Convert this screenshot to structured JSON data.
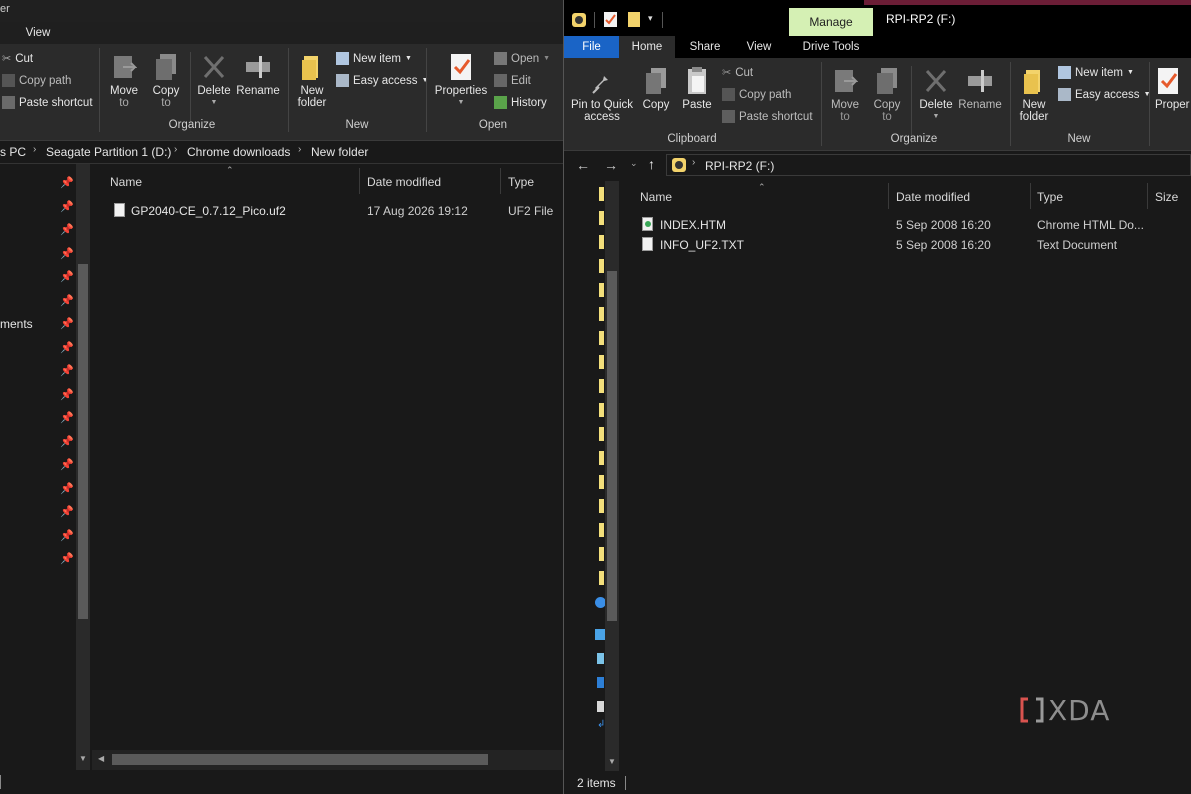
{
  "left": {
    "titlebar_text": "er",
    "tab_view": "View",
    "ribbon": {
      "cut": "Cut",
      "copy_path": "Copy path",
      "paste_shortcut": "Paste shortcut",
      "move_to": "Move",
      "move_to_2": "to",
      "copy_to": "Copy",
      "copy_to_2": "to",
      "delete": "Delete",
      "rename": "Rename",
      "new_folder": "New",
      "new_folder_2": "folder",
      "new_item": "New item",
      "easy_access": "Easy access",
      "properties": "Properties",
      "open": "Open",
      "edit": "Edit",
      "history": "History",
      "group_organize": "Organize",
      "group_new": "New",
      "group_open": "Open"
    },
    "breadcrumb": [
      "s PC",
      "Seagate Partition 1 (D:)",
      "Chrome downloads",
      "New folder"
    ],
    "nav_partial_label": "ments",
    "columns": {
      "name": "Name",
      "date": "Date modified",
      "type": "Type"
    },
    "files": [
      {
        "name": "GP2040-CE_0.7.12_Pico.uf2",
        "date": "17 Aug 2026 19:12",
        "type": "UF2 File"
      }
    ]
  },
  "right": {
    "manage_tab": "Manage",
    "title": "RPI-RP2 (F:)",
    "tabs": {
      "file": "File",
      "home": "Home",
      "share": "Share",
      "view": "View",
      "drive_tools": "Drive Tools"
    },
    "ribbon": {
      "pin_quick": "Pin to Quick",
      "pin_quick_2": "access",
      "copy": "Copy",
      "paste": "Paste",
      "cut": "Cut",
      "copy_path": "Copy path",
      "paste_shortcut": "Paste shortcut",
      "move_to": "Move",
      "move_to_2": "to",
      "copy_to": "Copy",
      "copy_to_2": "to",
      "delete": "Delete",
      "rename": "Rename",
      "new_folder": "New",
      "new_folder_2": "folder",
      "new_item": "New item",
      "easy_access": "Easy access",
      "properties": "Proper",
      "group_clipboard": "Clipboard",
      "group_organize": "Organize",
      "group_new": "New"
    },
    "address": "RPI-RP2 (F:)",
    "columns": {
      "name": "Name",
      "date": "Date modified",
      "type": "Type",
      "size": "Size"
    },
    "files": [
      {
        "name": "INDEX.HTM",
        "date": "5 Sep 2008 16:20",
        "type": "Chrome HTML Do..."
      },
      {
        "name": "INFO_UF2.TXT",
        "date": "5 Sep 2008 16:20",
        "type": "Text Document"
      }
    ],
    "status": "2 items"
  },
  "watermark": "XDA",
  "colors": {
    "manage_tab_bg": "#d5f0b4",
    "file_tab_bg": "#1a64c6",
    "folder_yellow": "#f3d36b",
    "accent_red": "#d9534f"
  }
}
